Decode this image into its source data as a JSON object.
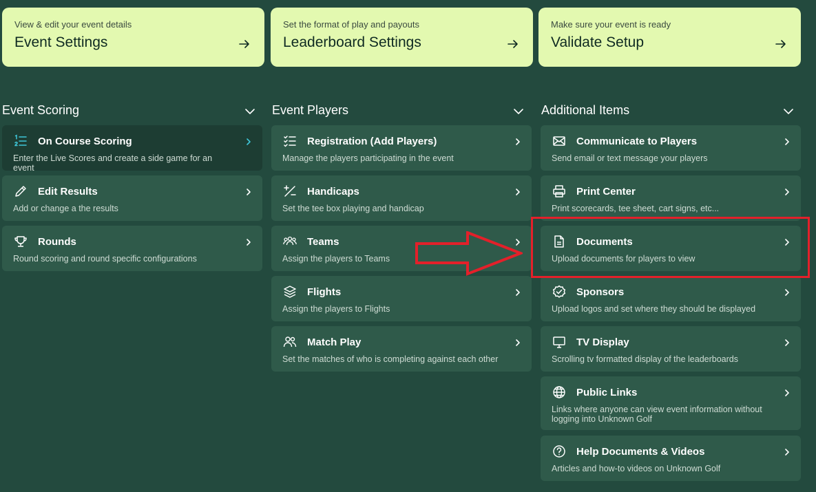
{
  "top_cards": [
    {
      "subtitle": "View & edit your event details",
      "title": "Event Settings"
    },
    {
      "subtitle": "Set the format of play and payouts",
      "title": "Leaderboard Settings"
    },
    {
      "subtitle": "Make sure your event is ready",
      "title": "Validate Setup"
    }
  ],
  "sections": {
    "event_scoring": {
      "title": "Event Scoring",
      "items": [
        {
          "title": "On Course Scoring",
          "desc": "Enter the Live Scores and create a side game for an event",
          "icon": "list-numbers-icon"
        },
        {
          "title": "Edit Results",
          "desc": "Add or change a the results",
          "icon": "pencil-icon"
        },
        {
          "title": "Rounds",
          "desc": "Round scoring and round specific configurations",
          "icon": "trophy-icon"
        }
      ]
    },
    "event_players": {
      "title": "Event Players",
      "items": [
        {
          "title": "Registration (Add Players)",
          "desc": "Manage the players participating in the event",
          "icon": "checklist-icon"
        },
        {
          "title": "Handicaps",
          "desc": "Set the tee box playing and handicap",
          "icon": "plus-minus-icon"
        },
        {
          "title": "Teams",
          "desc": "Assign the players to Teams",
          "icon": "users-group-icon"
        },
        {
          "title": "Flights",
          "desc": "Assign the players to Flights",
          "icon": "layers-icon"
        },
        {
          "title": "Match Play",
          "desc": "Set the matches of who is completing against each other",
          "icon": "two-users-icon"
        }
      ]
    },
    "additional_items": {
      "title": "Additional Items",
      "items": [
        {
          "title": "Communicate to Players",
          "desc": "Send email or text message your players",
          "icon": "envelope-icon"
        },
        {
          "title": "Print Center",
          "desc": "Print scorecards, tee sheet, cart signs, etc...",
          "icon": "printer-icon"
        },
        {
          "title": "Documents",
          "desc": "Upload documents for players to view",
          "icon": "document-icon"
        },
        {
          "title": "Sponsors",
          "desc": "Upload logos and set where they should be displayed",
          "icon": "badge-check-icon"
        },
        {
          "title": "TV Display",
          "desc": "Scrolling tv formatted display of the leaderboards",
          "icon": "monitor-icon"
        },
        {
          "title": "Public Links",
          "desc": "Links where anyone can view event information without logging into Unknown Golf",
          "icon": "globe-icon"
        },
        {
          "title": "Help Documents & Videos",
          "desc": "Articles and how-to videos on Unknown Golf",
          "icon": "help-circle-icon"
        }
      ]
    }
  },
  "colors": {
    "background": "#234a3e",
    "card": "#2f5a4a",
    "card_active": "#1d3d33",
    "top_card": "#e3f9b0",
    "accent": "#3fc7d9",
    "annotation_red": "#e3202a"
  }
}
